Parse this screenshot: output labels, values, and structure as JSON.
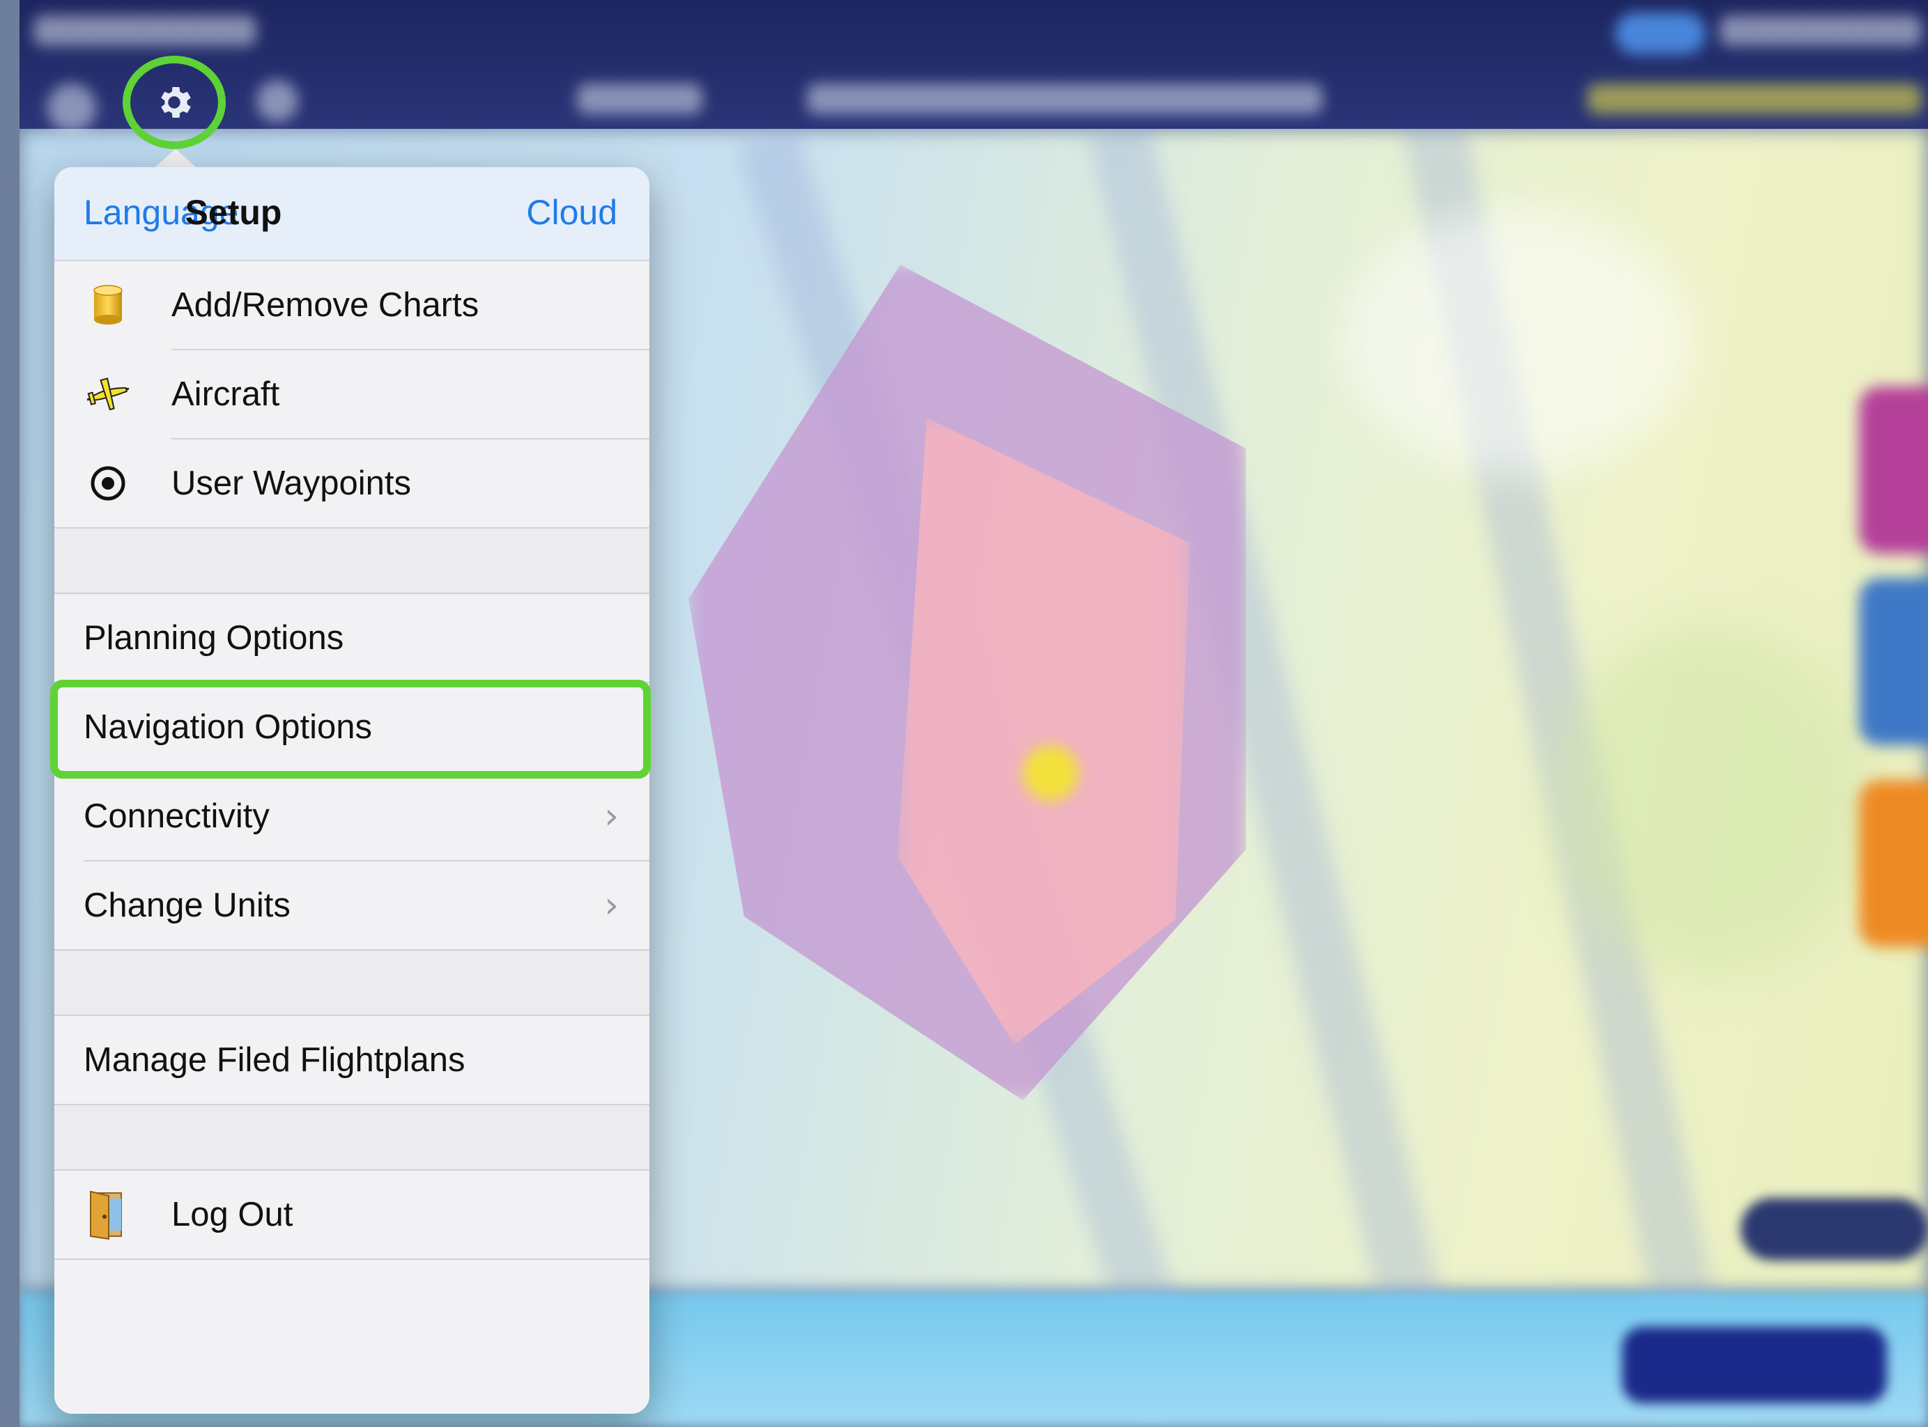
{
  "toolbar": {
    "settings_icon": "gear-icon",
    "highlight_color": "#5fd336"
  },
  "popover": {
    "left_button": "Language",
    "title": "Setup",
    "right_button": "Cloud",
    "items": [
      {
        "label": "Add/Remove Charts",
        "icon": "database-icon"
      },
      {
        "label": "Aircraft",
        "icon": "airplane-icon"
      },
      {
        "label": "User Waypoints",
        "icon": "target-icon"
      },
      {
        "label": "Planning Options"
      },
      {
        "label": "Navigation Options",
        "highlighted": true
      },
      {
        "label": "Connectivity",
        "disclosure": "›"
      },
      {
        "label": "Change Units",
        "disclosure": "›"
      },
      {
        "label": "Manage Filed Flightplans"
      },
      {
        "label": "Log Out",
        "icon": "door-icon"
      }
    ]
  },
  "colors": {
    "link": "#1f7be8",
    "header_bg": "#e6eef9",
    "popover_bg": "#f2f2f4"
  }
}
